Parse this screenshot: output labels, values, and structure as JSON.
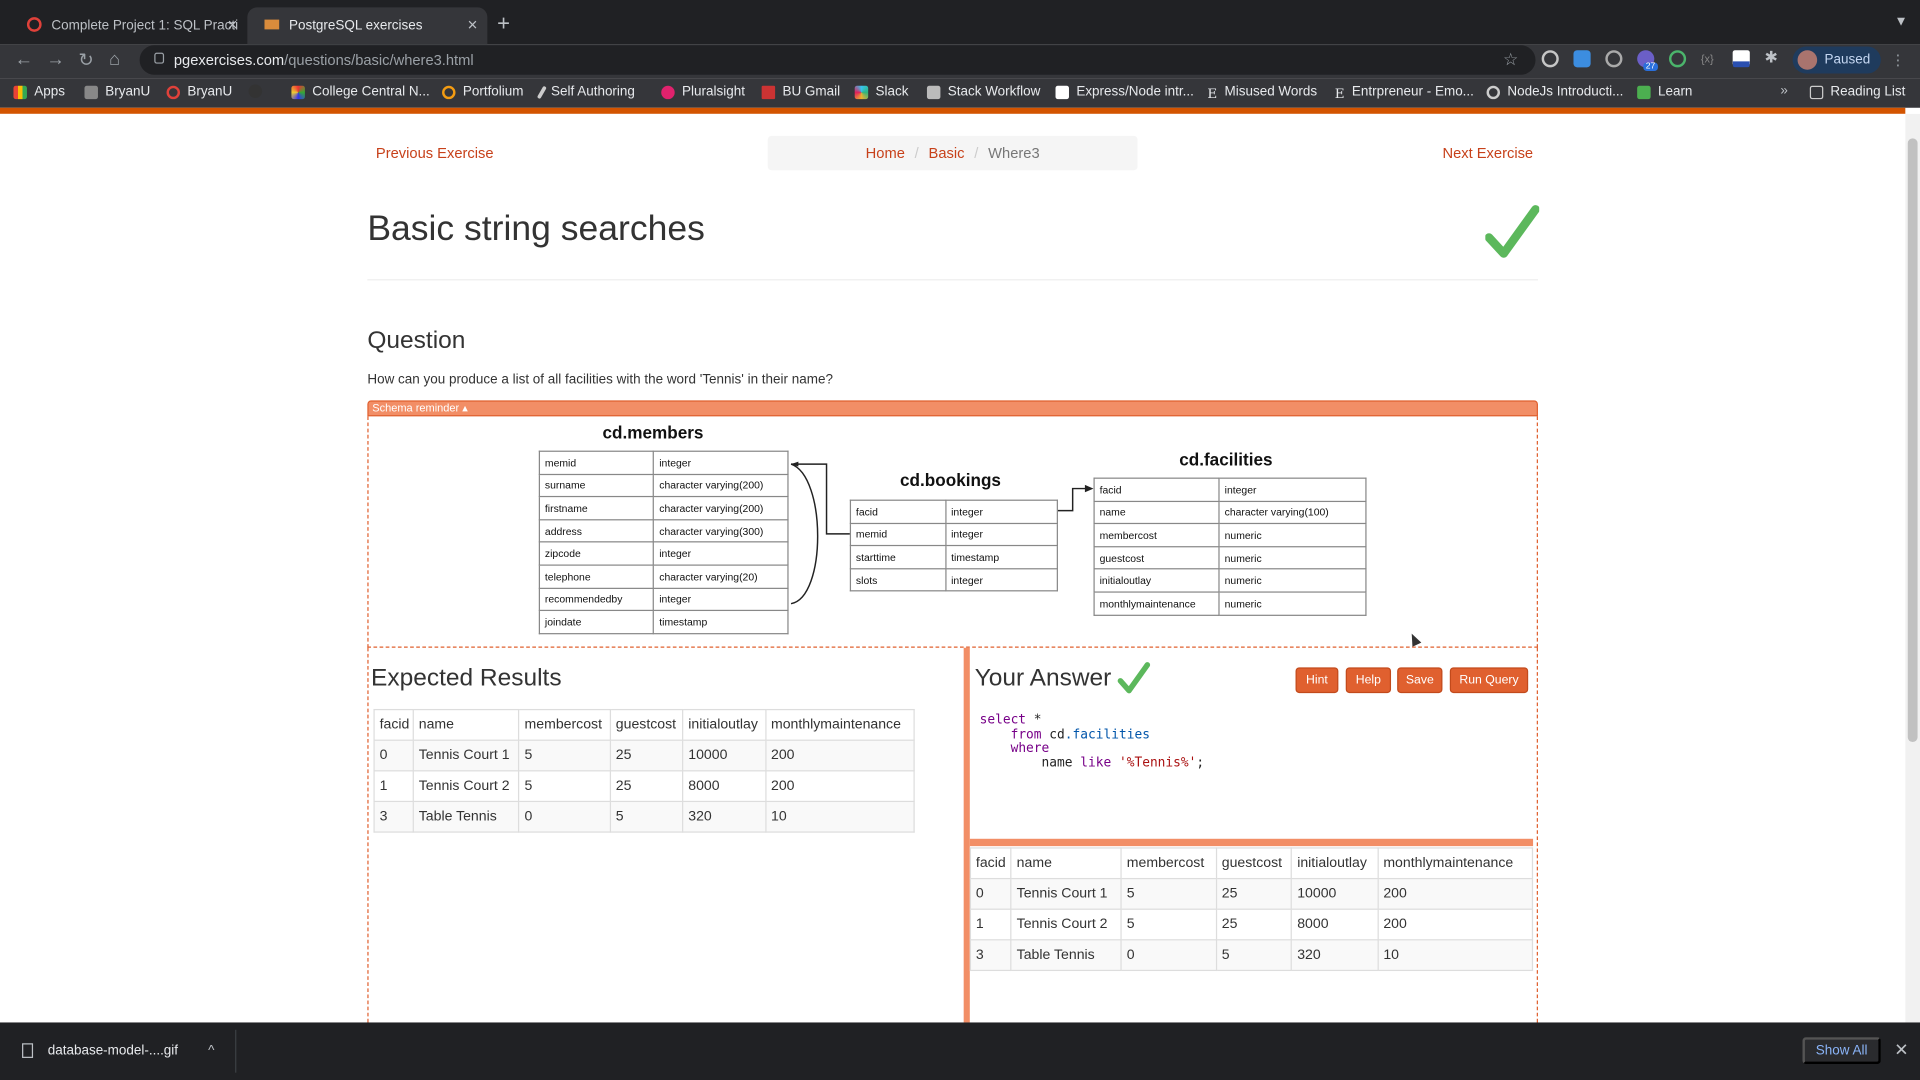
{
  "browser": {
    "tabs": [
      {
        "title": "Complete Project 1: SQL Practi",
        "active": false
      },
      {
        "title": "PostgreSQL exercises",
        "active": true
      }
    ],
    "url_domain": "pgexercises.com",
    "url_path": "/questions/basic/where3.html",
    "extension_badge": "27",
    "profile_label": "Paused",
    "bookmarks": [
      "Apps",
      "BryanU",
      "BryanU",
      "College Central N...",
      "Portfolium",
      "Self Authoring",
      "Pluralsight",
      "BU Gmail",
      "Slack",
      "Stack Workflow",
      "Express/Node intr...",
      "Misused Words",
      "Entrpreneur - Emo...",
      "NodeJs Introducti...",
      "Learn"
    ],
    "reading_list": "Reading List"
  },
  "nav": {
    "previous": "Previous Exercise",
    "next": "Next Exercise",
    "breadcrumb": [
      "Home",
      "Basic",
      "Where3"
    ]
  },
  "page": {
    "title": "Basic string searches",
    "question_heading": "Question",
    "question_text": "How can you produce a list of all facilities with the word 'Tennis' in their name?",
    "schema_label": "Schema reminder ▴"
  },
  "schema": {
    "members": {
      "name": "cd.members",
      "rows": [
        [
          "memid",
          "integer"
        ],
        [
          "surname",
          "character varying(200)"
        ],
        [
          "firstname",
          "character varying(200)"
        ],
        [
          "address",
          "character varying(300)"
        ],
        [
          "zipcode",
          "integer"
        ],
        [
          "telephone",
          "character varying(20)"
        ],
        [
          "recommendedby",
          "integer"
        ],
        [
          "joindate",
          "timestamp"
        ]
      ]
    },
    "bookings": {
      "name": "cd.bookings",
      "rows": [
        [
          "facid",
          "integer"
        ],
        [
          "memid",
          "integer"
        ],
        [
          "starttime",
          "timestamp"
        ],
        [
          "slots",
          "integer"
        ]
      ]
    },
    "facilities": {
      "name": "cd.facilities",
      "rows": [
        [
          "facid",
          "integer"
        ],
        [
          "name",
          "character varying(100)"
        ],
        [
          "membercost",
          "numeric"
        ],
        [
          "guestcost",
          "numeric"
        ],
        [
          "initialoutlay",
          "numeric"
        ],
        [
          "monthlymaintenance",
          "numeric"
        ]
      ]
    }
  },
  "expected": {
    "heading": "Expected Results",
    "columns": [
      "facid",
      "name",
      "membercost",
      "guestcost",
      "initialoutlay",
      "monthlymaintenance"
    ],
    "rows": [
      [
        "0",
        "Tennis Court 1",
        "5",
        "25",
        "10000",
        "200"
      ],
      [
        "1",
        "Tennis Court 2",
        "5",
        "25",
        "8000",
        "200"
      ],
      [
        "3",
        "Table Tennis",
        "0",
        "5",
        "320",
        "10"
      ]
    ]
  },
  "answer": {
    "heading": "Your Answer",
    "buttons": {
      "hint": "Hint",
      "help": "Help",
      "save": "Save",
      "run": "Run Query"
    },
    "code": {
      "l1a": "select",
      "l1b": " *",
      "l2a": "from",
      "l2b": "cd",
      "l2c": ".facilities",
      "l3": "where",
      "l4a": "name",
      "l4b": "like",
      "l4c": "'%Tennis%'",
      "l4d": ";"
    },
    "columns": [
      "facid",
      "name",
      "membercost",
      "guestcost",
      "initialoutlay",
      "monthlymaintenance"
    ],
    "rows": [
      [
        "0",
        "Tennis Court 1",
        "5",
        "25",
        "10000",
        "200"
      ],
      [
        "1",
        "Tennis Court 2",
        "5",
        "25",
        "8000",
        "200"
      ],
      [
        "3",
        "Table Tennis",
        "0",
        "5",
        "320",
        "10"
      ]
    ]
  },
  "download": {
    "file": "database-model-....gif",
    "show_all": "Show All"
  },
  "colors": {
    "accent": "#e0602f",
    "link": "#c7411a",
    "check": "#5cb85c"
  }
}
